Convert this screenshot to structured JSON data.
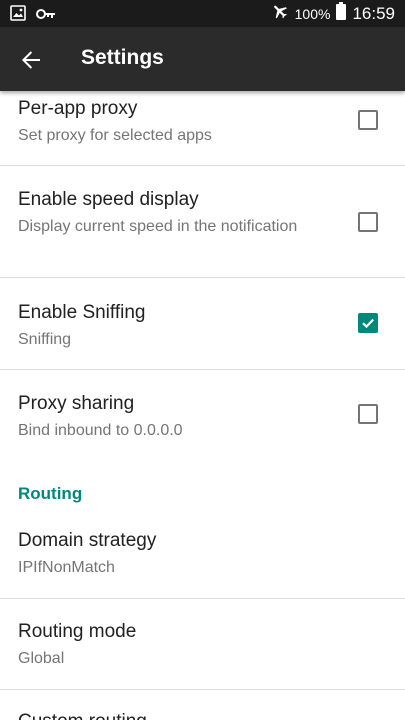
{
  "status_bar": {
    "battery_percent": "100%",
    "time": "16:59"
  },
  "toolbar": {
    "title": "Settings"
  },
  "prefs": [
    {
      "title": "Per-app proxy",
      "summary": "Set proxy for selected apps",
      "checked": false
    },
    {
      "title": "Enable speed display",
      "summary": "Display current speed in the notification",
      "checked": false
    },
    {
      "title": "Enable Sniffing",
      "summary": "Sniffing",
      "checked": true
    },
    {
      "title": "Proxy sharing",
      "summary": "Bind inbound to 0.0.0.0",
      "checked": false
    }
  ],
  "routing_section": {
    "header": "Routing",
    "items": [
      {
        "title": "Domain strategy",
        "summary": "IPIfNonMatch"
      },
      {
        "title": "Routing mode",
        "summary": "Global"
      },
      {
        "title": "Custom routing"
      }
    ]
  },
  "colors": {
    "accent": "#00897b",
    "toolbar": "#2b2b2b",
    "status_bar": "#1b1b1b"
  }
}
